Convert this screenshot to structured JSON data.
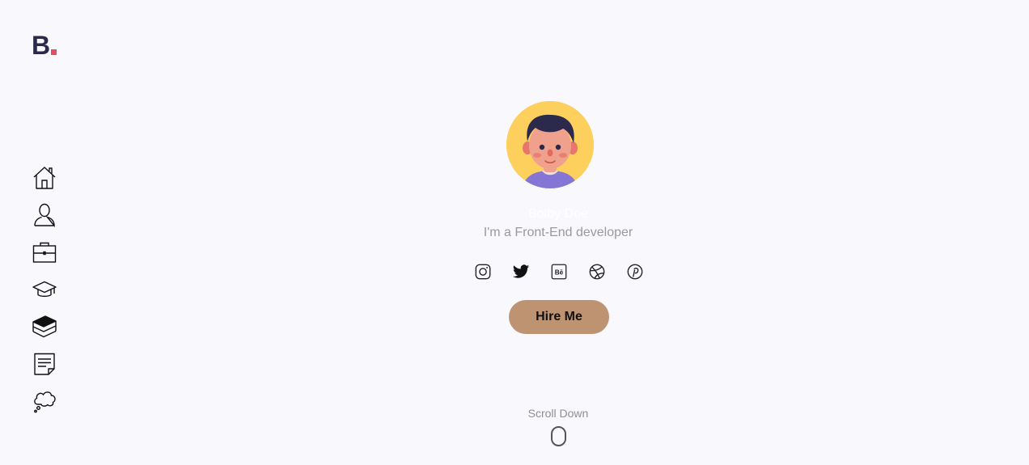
{
  "brand": {
    "letter": "B",
    "dot_color": "#e84c5f",
    "text_color": "#2b2a4c"
  },
  "sidebar": {
    "items": [
      {
        "icon": "home-icon"
      },
      {
        "icon": "user-icon"
      },
      {
        "icon": "briefcase-icon"
      },
      {
        "icon": "graduation-cap-icon"
      },
      {
        "icon": "layers-icon"
      },
      {
        "icon": "note-icon"
      },
      {
        "icon": "thought-cloud-icon"
      }
    ]
  },
  "profile": {
    "name": "Bolby Doe",
    "role": "I'm a Front-End developer"
  },
  "socials": [
    {
      "icon": "instagram-icon"
    },
    {
      "icon": "twitter-icon"
    },
    {
      "icon": "behance-icon",
      "label": "Bē"
    },
    {
      "icon": "dribbble-icon"
    },
    {
      "icon": "pinterest-icon"
    }
  ],
  "cta": {
    "label": "Hire Me",
    "color": "#bd9372"
  },
  "scroll": {
    "label": "Scroll Down"
  },
  "colors": {
    "background": "#f9f8fc",
    "avatar_bg": "#fdd05d"
  }
}
